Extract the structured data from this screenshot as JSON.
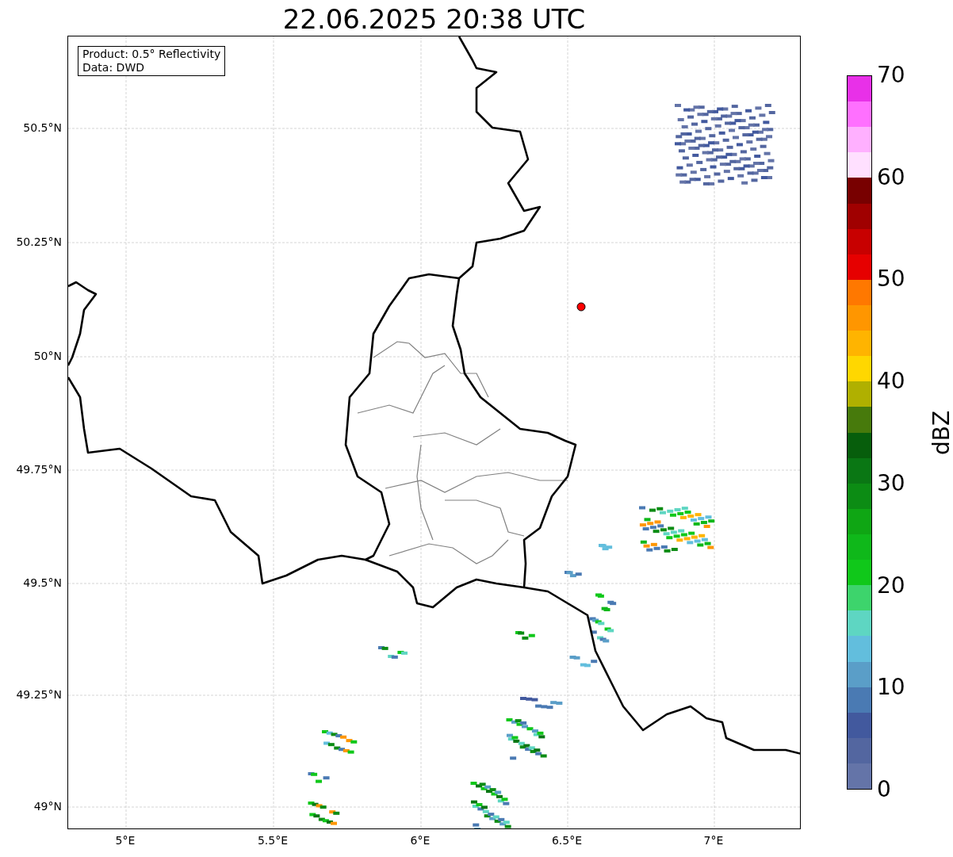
{
  "title": "22.06.2025 20:38 UTC",
  "info_box": [
    "Product: 0.5° Reflectivity",
    "Data: DWD"
  ],
  "map": {
    "xticks": [
      "5°E",
      "5.5°E",
      "6°E",
      "6.5°E",
      "7°E"
    ],
    "yticks": [
      "50.5°N",
      "50.25°N",
      "50°N",
      "49.75°N",
      "49.5°N",
      "49.25°N",
      "49°N"
    ]
  },
  "colorbar": {
    "label": "dBZ",
    "ticks": [
      "70",
      "60",
      "50",
      "40",
      "30",
      "20",
      "10",
      "0"
    ],
    "bins": [
      {
        "color": "#e830e8"
      },
      {
        "color": "#ff70ff"
      },
      {
        "color": "#ffb0ff"
      },
      {
        "color": "#ffe0ff"
      },
      {
        "color": "#780000"
      },
      {
        "color": "#a00000"
      },
      {
        "color": "#c80000"
      },
      {
        "color": "#e60000"
      },
      {
        "color": "#ff7800"
      },
      {
        "color": "#ff9600"
      },
      {
        "color": "#ffb400"
      },
      {
        "color": "#ffd700"
      },
      {
        "color": "#b0b000"
      },
      {
        "color": "#477a0c"
      },
      {
        "color": "#075e0c"
      },
      {
        "color": "#0a7714"
      },
      {
        "color": "#0c8c14"
      },
      {
        "color": "#0fa614"
      },
      {
        "color": "#0fb81a"
      },
      {
        "color": "#10c81a"
      },
      {
        "color": "#3dd46c"
      },
      {
        "color": "#5ed6c2"
      },
      {
        "color": "#62bedd"
      },
      {
        "color": "#5a9ec8"
      },
      {
        "color": "#4a7ab3"
      },
      {
        "color": "#42599e"
      },
      {
        "color": "#5366a0"
      },
      {
        "color": "#6474a8"
      }
    ]
  }
}
